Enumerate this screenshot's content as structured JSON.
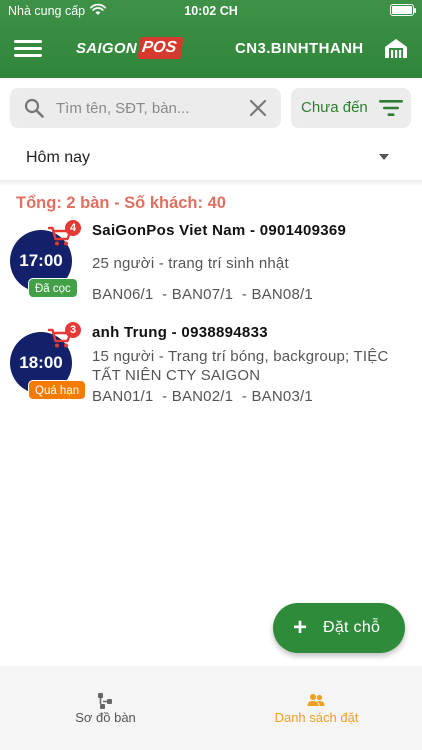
{
  "status_bar": {
    "carrier": "Nhà cung cấp",
    "time": "10:02 CH"
  },
  "app_bar": {
    "logo_text": "SAIGON",
    "logo_pos": "POS",
    "branch": "CN3.BINHTHANH"
  },
  "search": {
    "placeholder": "Tìm tên, SĐT, bàn...",
    "value": ""
  },
  "status_filter": {
    "label": "Chưa đến"
  },
  "date_filter": {
    "selected": "Hôm nay"
  },
  "summary": "Tổng: 2 bàn - Số khách: 40",
  "bookings": [
    {
      "time": "17:00",
      "cart_count": "4",
      "status": "Đã cọc",
      "name": "SaiGonPos Viet Nam - 0901409369",
      "note": "25 người  - trang trí sinh nhật",
      "tables": "BAN06/1  - BAN07/1  - BAN08/1"
    },
    {
      "time": "18:00",
      "cart_count": "3",
      "status": "Quá hạn",
      "name": "anh Trung - 0938894833",
      "note": "15 người  - Trang trí bóng, backgroup; TIỆC TẤT NIÊN CTY SAIGON",
      "tables": "BAN01/1  - BAN02/1  - BAN03/1"
    }
  ],
  "fab": {
    "label": "Đặt chỗ"
  },
  "bottom_nav": [
    {
      "label": "Sơ đồ bàn",
      "icon": "table-map-icon"
    },
    {
      "label": "Danh sách đặt",
      "icon": "people-icon",
      "active": true
    }
  ],
  "colors": {
    "primary": "#2e8b3a",
    "time_circle": "#13206a",
    "summary": "#e07060",
    "deposit_badge": "#43a047",
    "overdue_badge": "#f57c00",
    "active_nav": "#f0a020"
  }
}
